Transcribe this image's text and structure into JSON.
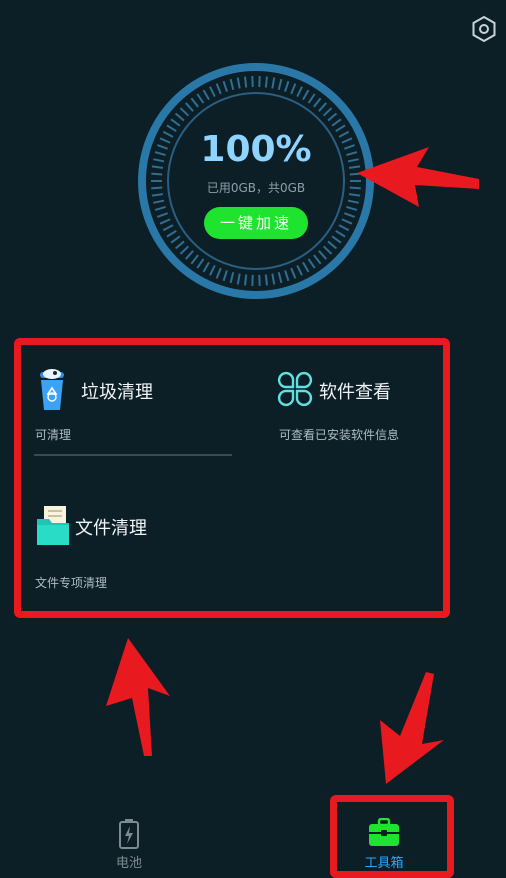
{
  "gauge": {
    "percent_text": "100%",
    "percent_value": 100,
    "usage_text": "已用0GB，共0GB",
    "speed_button_label": "一键加速"
  },
  "tools": {
    "trash": {
      "title": "垃圾清理",
      "desc": "可清理"
    },
    "apps": {
      "title": "软件查看",
      "desc": "可查看已安装软件信息"
    },
    "files": {
      "title": "文件清理",
      "desc": "文件专项清理"
    }
  },
  "bottom_nav": {
    "tabs": [
      {
        "label": "电池",
        "icon": "battery-icon",
        "active": false
      },
      {
        "label": "工具箱",
        "icon": "toolbox-icon",
        "active": true
      }
    ]
  },
  "colors": {
    "background": "#0c1e26",
    "accent_blue": "#8fd3ff",
    "button_green": "#1ee42f",
    "annotation_red": "#e8191f",
    "active_tab": "#2aa8ff"
  }
}
